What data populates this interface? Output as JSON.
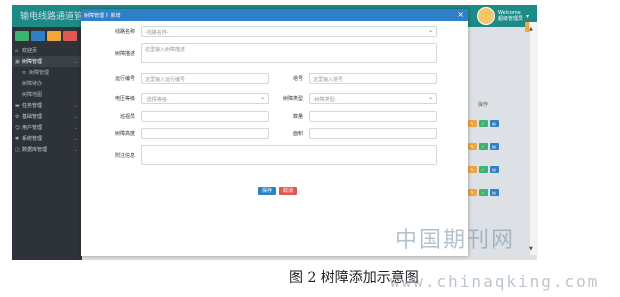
{
  "topbar": {
    "title": "输电线路通道管",
    "user_name": "Welcome",
    "user_role": "超级管理员"
  },
  "sidebar": {
    "items": [
      {
        "label": "欢迎页",
        "icon": "home-icon"
      },
      {
        "label": "树障管理",
        "icon": "tree-icon",
        "active": true
      },
      {
        "label": "树障管理",
        "icon": "list-icon",
        "sub": true
      },
      {
        "label": "树障待办",
        "icon": "",
        "sub": true
      },
      {
        "label": "树障地图",
        "icon": "",
        "sub": true
      },
      {
        "label": "任务管理",
        "icon": "folder-icon"
      },
      {
        "label": "基础管理",
        "icon": "gear-icon"
      },
      {
        "label": "用户管理",
        "icon": "user-icon"
      },
      {
        "label": "系统管理",
        "icon": "settings-icon"
      },
      {
        "label": "数据库管理",
        "icon": "database-icon"
      }
    ]
  },
  "table": {
    "ops_header": "操作"
  },
  "modal": {
    "title": "树障管理 》新增",
    "fields": {
      "line_name": {
        "label": "线路名称",
        "placeholder": "-线路名称-"
      },
      "obstacle_desc": {
        "label": "树障描述",
        "placeholder": "这里输入树障描述"
      },
      "run_number": {
        "label": "运行编号",
        "placeholder": "这里输入运行编号"
      },
      "tower_number": {
        "label": "塔号",
        "placeholder": "这里输入塔号"
      },
      "voltage": {
        "label": "电压等级",
        "placeholder": "-选择等级-"
      },
      "obstacle_type": {
        "label": "树障类型",
        "placeholder": "-树障类型-"
      },
      "inspector": {
        "label": "巡视员",
        "placeholder": ""
      },
      "quantity": {
        "label": "数量",
        "placeholder": ""
      },
      "tree_height": {
        "label": "树障高度",
        "placeholder": ""
      },
      "area": {
        "label": "面积",
        "placeholder": ""
      },
      "note": {
        "label": "附注信息",
        "placeholder": ""
      }
    },
    "save_label": "保存",
    "cancel_label": "取消"
  },
  "caption": "图 2  树障添加示意图",
  "watermark_cn": "中国期刊网",
  "watermark_url": "www.chinaqking.com",
  "colors": {
    "topbar": "#1e8a86",
    "sidebar": "#2d3339",
    "modal_header": "#2f7fc9",
    "save": "#2f80c4",
    "cancel": "#e0584f"
  }
}
